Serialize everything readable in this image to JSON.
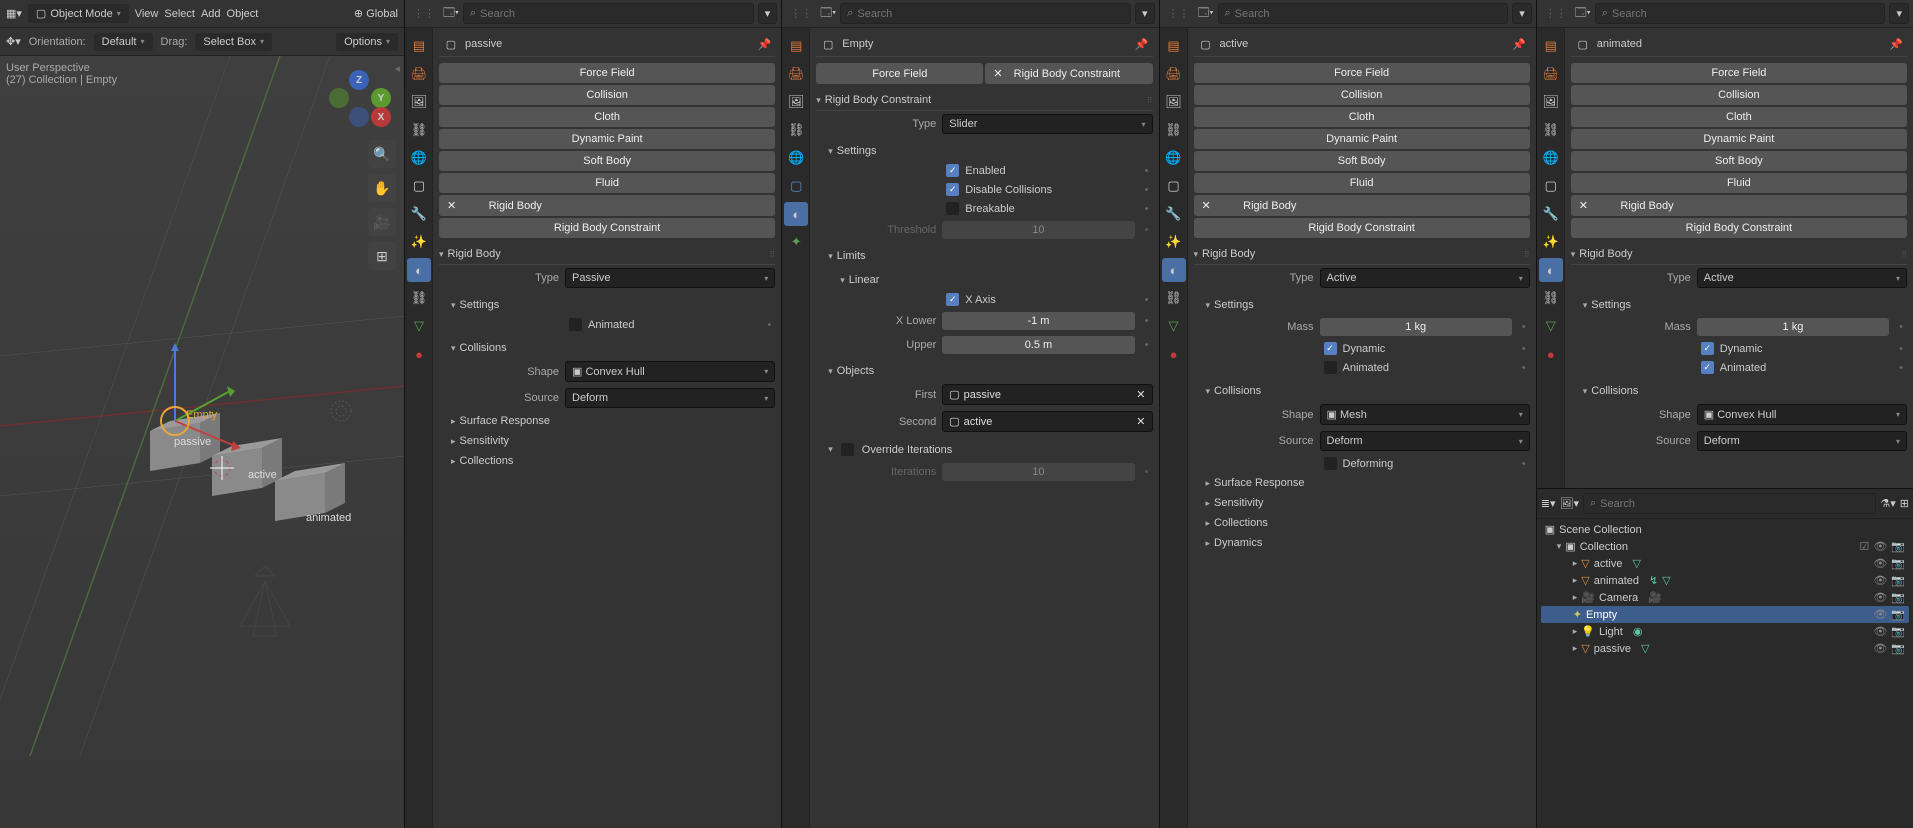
{
  "viewport": {
    "mode": "Object Mode",
    "menus": [
      "View",
      "Select",
      "Add",
      "Object"
    ],
    "coord": "Global",
    "orient_label": "Orientation:",
    "orient_value": "Default",
    "drag_label": "Drag:",
    "drag_value": "Select Box",
    "options": "Options",
    "perspective": "User Perspective",
    "collection_info": "(27) Collection  |  Empty",
    "objs": {
      "empty": "Empty",
      "passive": "passive",
      "active": "active",
      "animated": "animated"
    }
  },
  "search_placeholder": "Search",
  "panels": [
    {
      "obj": "passive",
      "physics_buttons": [
        "Force Field",
        "Collision",
        "Cloth",
        "Dynamic Paint",
        "Soft Body",
        "Fluid",
        "Rigid Body",
        "Rigid Body Constraint"
      ],
      "rigid_body": {
        "title": "Rigid Body",
        "type_label": "Type",
        "type": "Passive",
        "settings": "Settings",
        "animated_label": "Animated",
        "animated": false,
        "collisions": "Collisions",
        "shape_label": "Shape",
        "shape": "Convex Hull",
        "source_label": "Source",
        "source": "Deform",
        "surface": "Surface Response",
        "sensitivity": "Sensitivity",
        "colls": "Collections"
      }
    },
    {
      "obj": "Empty",
      "physics_buttons": [
        "Force Field"
      ],
      "rbc_remove": "Rigid Body Constraint",
      "rbc": {
        "title": "Rigid Body Constraint",
        "type_label": "Type",
        "type": "Slider",
        "settings": "Settings",
        "enabled_label": "Enabled",
        "enabled": true,
        "disable_label": "Disable Collisions",
        "disable": true,
        "breakable_label": "Breakable",
        "breakable": false,
        "threshold_label": "Threshold",
        "threshold": "10",
        "limits": "Limits",
        "linear": "Linear",
        "x_axis_label": "X Axis",
        "x_axis": true,
        "x_lower_label": "X Lower",
        "x_lower": "-1 m",
        "upper_label": "Upper",
        "upper": "0.5 m",
        "objects": "Objects",
        "first_label": "First",
        "first": "passive",
        "second_label": "Second",
        "second": "active",
        "override_label": "Override Iterations",
        "override": false,
        "iterations_label": "Iterations",
        "iterations": "10"
      }
    },
    {
      "obj": "active",
      "physics_buttons": [
        "Force Field",
        "Collision",
        "Cloth",
        "Dynamic Paint",
        "Soft Body",
        "Fluid",
        "Rigid Body",
        "Rigid Body Constraint"
      ],
      "rigid_body": {
        "title": "Rigid Body",
        "type_label": "Type",
        "type": "Active",
        "settings": "Settings",
        "mass_label": "Mass",
        "mass": "1 kg",
        "dynamic_label": "Dynamic",
        "dynamic": true,
        "animated_label": "Animated",
        "animated": false,
        "collisions": "Collisions",
        "shape_label": "Shape",
        "shape": "Mesh",
        "source_label": "Source",
        "source": "Deform",
        "deforming_label": "Deforming",
        "deforming": false,
        "surface": "Surface Response",
        "sensitivity": "Sensitivity",
        "colls": "Collections",
        "dynamics": "Dynamics"
      }
    },
    {
      "obj": "animated",
      "physics_buttons": [
        "Force Field",
        "Collision",
        "Cloth",
        "Dynamic Paint",
        "Soft Body",
        "Fluid",
        "Rigid Body",
        "Rigid Body Constraint"
      ],
      "rigid_body": {
        "title": "Rigid Body",
        "type_label": "Type",
        "type": "Active",
        "settings": "Settings",
        "mass_label": "Mass",
        "mass": "1 kg",
        "dynamic_label": "Dynamic",
        "dynamic": true,
        "animated_label": "Animated",
        "animated": true,
        "collisions": "Collisions",
        "shape_label": "Shape",
        "shape": "Convex Hull",
        "source_label": "Source",
        "source": "Deform"
      }
    }
  ],
  "outliner": {
    "scene": "Scene Collection",
    "collection": "Collection",
    "items": [
      {
        "name": "active",
        "type": "mesh"
      },
      {
        "name": "animated",
        "type": "mesh"
      },
      {
        "name": "Camera",
        "type": "camera"
      },
      {
        "name": "Empty",
        "type": "empty",
        "selected": true
      },
      {
        "name": "Light",
        "type": "light"
      },
      {
        "name": "passive",
        "type": "mesh"
      }
    ]
  }
}
